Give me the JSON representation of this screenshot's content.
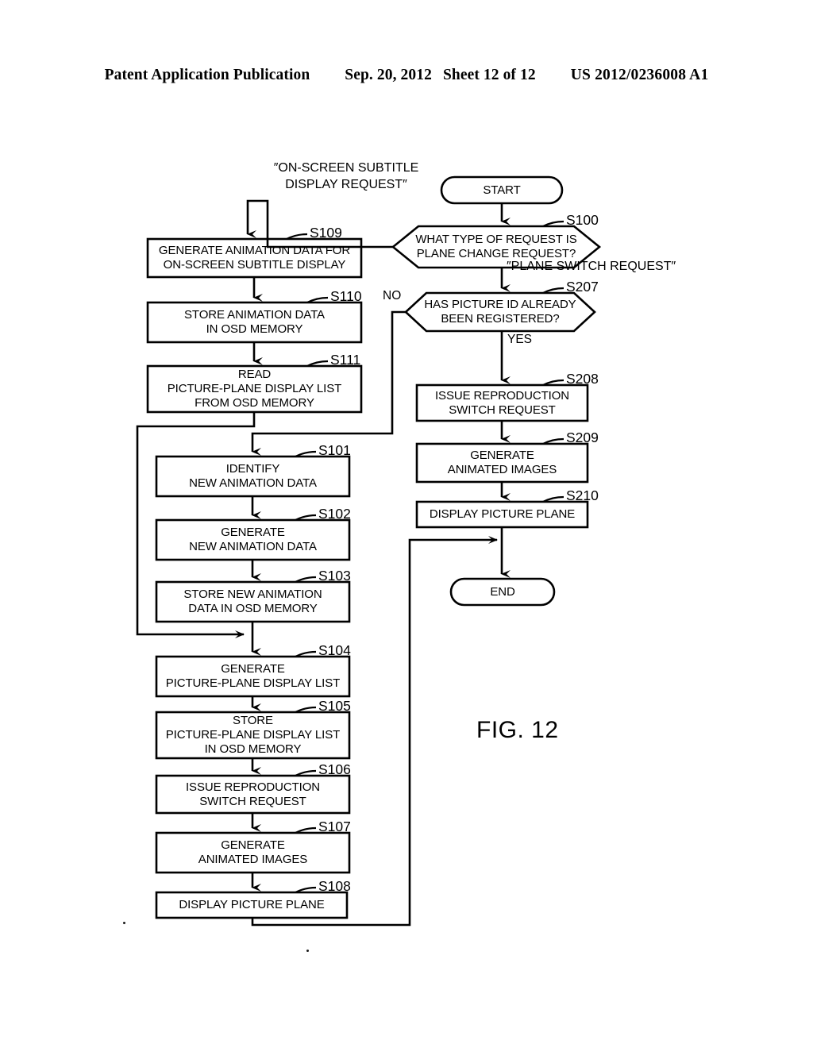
{
  "header": {
    "publication": "Patent Application Publication",
    "date": "Sep. 20, 2012",
    "sheet": "Sheet 12 of 12",
    "number": "US 2012/0236008 A1"
  },
  "figure": {
    "caption": "FIG. 12"
  },
  "callouts": {
    "on_screen_request_line1": "″ON-SCREEN SUBTITLE",
    "on_screen_request_line2": "DISPLAY REQUEST″",
    "plane_switch_request": "″PLANE SWITCH REQUEST″"
  },
  "edge_labels": {
    "no": "NO",
    "yes": "YES"
  },
  "terminals": {
    "start": "START",
    "end": "END"
  },
  "nodes": [
    {
      "id": "S109",
      "tag": "S109",
      "shape": "process",
      "lines": [
        "GENERATE ANIMATION DATA FOR",
        "ON-SCREEN SUBTITLE DISPLAY"
      ]
    },
    {
      "id": "S110",
      "tag": "S110",
      "shape": "process",
      "lines": [
        "STORE ANIMATION DATA",
        "IN OSD MEMORY"
      ]
    },
    {
      "id": "S111",
      "tag": "S111",
      "shape": "process",
      "lines": [
        "READ",
        "PICTURE-PLANE DISPLAY LIST",
        "FROM OSD MEMORY"
      ]
    },
    {
      "id": "S101",
      "tag": "S101",
      "shape": "process",
      "lines": [
        "IDENTIFY",
        "NEW ANIMATION DATA"
      ]
    },
    {
      "id": "S102",
      "tag": "S102",
      "shape": "process",
      "lines": [
        "GENERATE",
        "NEW ANIMATION DATA"
      ]
    },
    {
      "id": "S103",
      "tag": "S103",
      "shape": "process",
      "lines": [
        "STORE NEW ANIMATION",
        "DATA IN OSD MEMORY"
      ]
    },
    {
      "id": "S104",
      "tag": "S104",
      "shape": "process",
      "lines": [
        "GENERATE",
        "PICTURE-PLANE DISPLAY LIST"
      ]
    },
    {
      "id": "S105",
      "tag": "S105",
      "shape": "process",
      "lines": [
        "STORE",
        "PICTURE-PLANE DISPLAY LIST",
        "IN OSD MEMORY"
      ]
    },
    {
      "id": "S106",
      "tag": "S106",
      "shape": "process",
      "lines": [
        "ISSUE REPRODUCTION",
        "SWITCH REQUEST"
      ]
    },
    {
      "id": "S107",
      "tag": "S107",
      "shape": "process",
      "lines": [
        "GENERATE",
        "ANIMATED IMAGES"
      ]
    },
    {
      "id": "S108",
      "tag": "S108",
      "shape": "process",
      "lines": [
        "DISPLAY PICTURE PLANE"
      ]
    },
    {
      "id": "S100",
      "tag": "S100",
      "shape": "decision",
      "lines": [
        "WHAT TYPE OF REQUEST IS",
        "PLANE CHANGE  REQUEST?"
      ]
    },
    {
      "id": "S207",
      "tag": "S207",
      "shape": "decision",
      "lines": [
        "HAS PICTURE ID ALREADY",
        "BEEN REGISTERED?"
      ]
    },
    {
      "id": "S208",
      "tag": "S208",
      "shape": "process",
      "lines": [
        "ISSUE REPRODUCTION",
        "SWITCH REQUEST"
      ]
    },
    {
      "id": "S209",
      "tag": "S209",
      "shape": "process",
      "lines": [
        "GENERATE",
        "ANIMATED IMAGES"
      ]
    },
    {
      "id": "S210",
      "tag": "S210",
      "shape": "process",
      "lines": [
        "DISPLAY PICTURE PLANE"
      ]
    }
  ],
  "colors": {
    "ink": "#000000",
    "paper": "#ffffff"
  }
}
